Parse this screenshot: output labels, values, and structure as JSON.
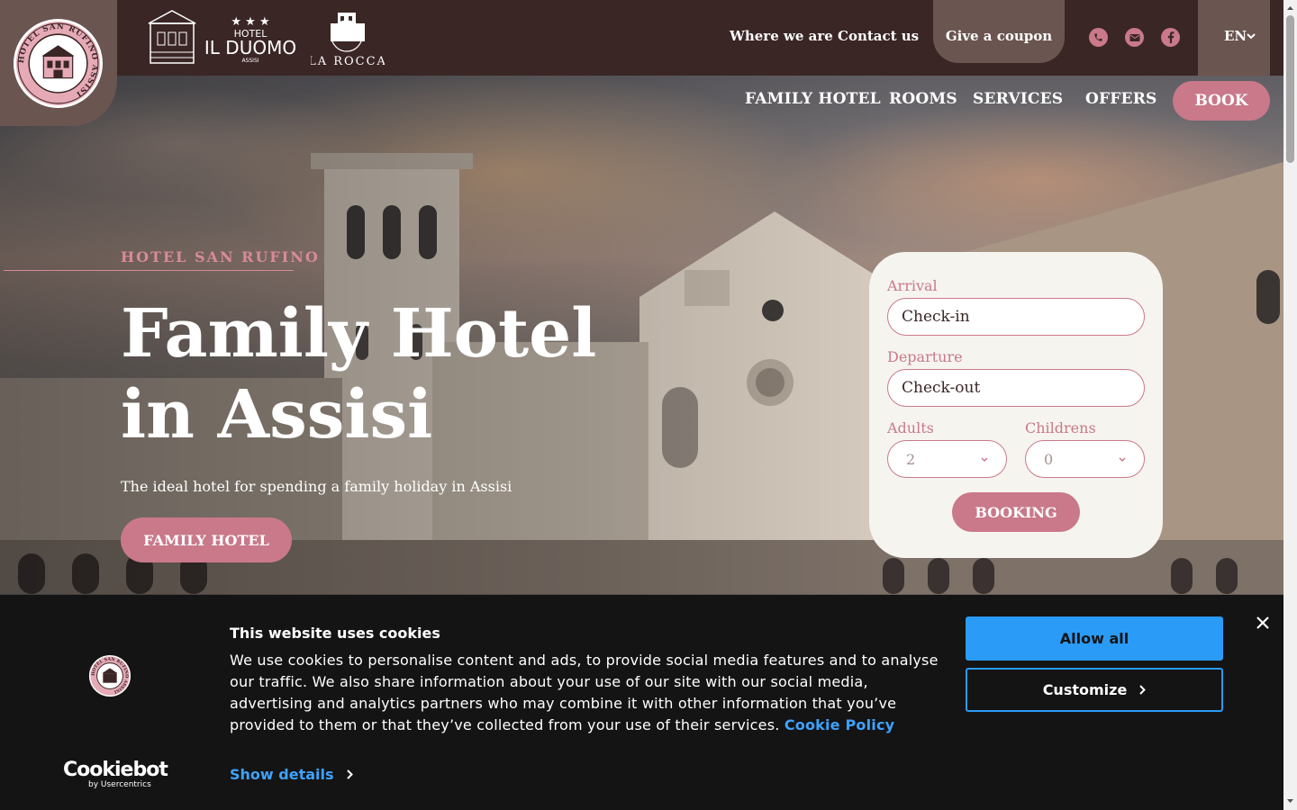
{
  "header": {
    "logo_text": "HOTEL SAN RUFINO ASSISI",
    "partner_duomo": {
      "stars": "★ ★ ★",
      "line1": "HOTEL",
      "line2": "IL DUOMO",
      "line3": "ASSISI"
    },
    "partner_rocca": {
      "name": "LA ROCCA"
    },
    "links": {
      "where": "Where we are",
      "contact": "Contact us",
      "coupon": "Give a coupon"
    },
    "social_icons": [
      "phone-icon",
      "mail-icon",
      "facebook-icon"
    ],
    "language": "EN"
  },
  "nav": {
    "items": [
      "FAMILY HOTEL",
      "ROOMS",
      "SERVICES",
      "OFFERS"
    ],
    "book": "BOOK"
  },
  "hero": {
    "eyebrow": "HOTEL SAN RUFINO",
    "title": "Family Hotel in Assisi",
    "subtitle": "The ideal hotel for spending a family holiday in Assisi",
    "button": "FAMILY HOTEL"
  },
  "booking": {
    "arrival_label": "Arrival",
    "arrival_value": "Check-in",
    "departure_label": "Departure",
    "departure_value": "Check-out",
    "adults_label": "Adults",
    "adults_value": "2",
    "children_label": "Childrens",
    "children_value": "0",
    "button": "BOOKING"
  },
  "cookie": {
    "title": "This website uses cookies",
    "text": "We use cookies to personalise content and ads, to provide social media features and to analyse our traffic. We also share information about your use of our site with our social media, advertising and analytics partners who may combine it with other information that you’ve provided to them or that they’ve collected from your use of their services.",
    "policy_link": "Cookie Policy",
    "show_details": "Show details",
    "allow_all": "Allow all",
    "customize": "Customize",
    "brand": "Cookiebot",
    "brand_sub": "by Usercentrics"
  },
  "colors": {
    "brown": "#3a2625",
    "tab_brown": "#6b5550",
    "rose": "#c9798a",
    "cookie_blue": "#2a9bf7"
  }
}
